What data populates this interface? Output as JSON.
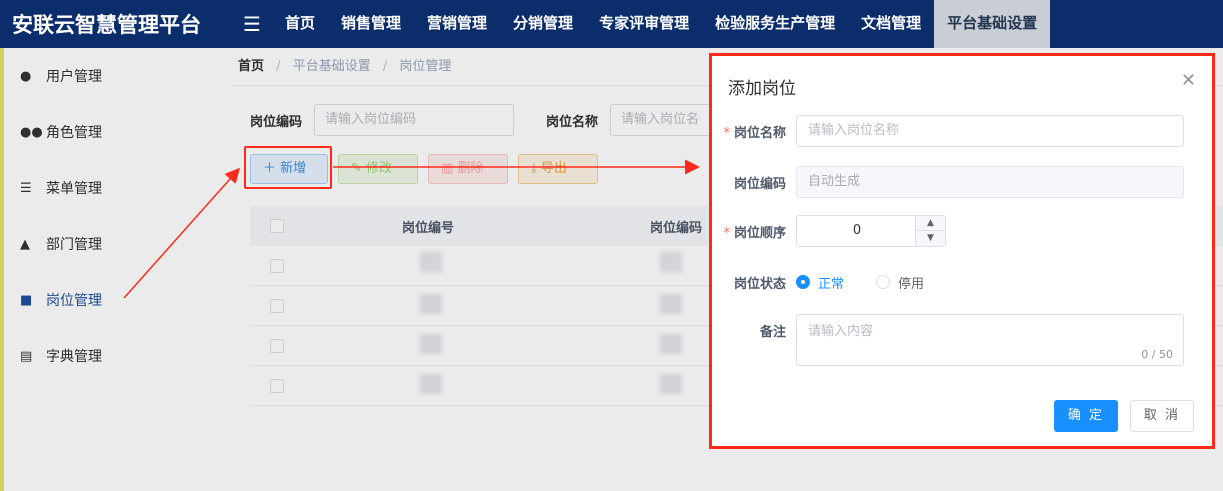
{
  "app": {
    "title": "安联云智慧管理平台"
  },
  "topnav": {
    "items": [
      "首页",
      "销售管理",
      "营销管理",
      "分销管理",
      "专家评审管理",
      "检验服务生产管理",
      "文档管理",
      "平台基础设置"
    ],
    "active": "平台基础设置"
  },
  "sidebar": {
    "items": [
      {
        "label": "用户管理",
        "icon": "user-icon"
      },
      {
        "label": "角色管理",
        "icon": "users-icon"
      },
      {
        "label": "菜单管理",
        "icon": "menu-tree-icon"
      },
      {
        "label": "部门管理",
        "icon": "org-tree-icon"
      },
      {
        "label": "岗位管理",
        "icon": "post-icon"
      },
      {
        "label": "字典管理",
        "icon": "dictionary-icon"
      }
    ],
    "active": "岗位管理"
  },
  "breadcrumb": [
    "首页",
    "平台基础设置",
    "岗位管理"
  ],
  "search": {
    "code_label": "岗位编码",
    "code_placeholder": "请输入岗位编码",
    "name_label": "岗位名称",
    "name_placeholder": "请输入岗位名"
  },
  "toolbar": {
    "add": "新增",
    "edit": "修改",
    "delete": "删除",
    "export": "导出"
  },
  "table": {
    "columns": [
      "岗位编号",
      "岗位编码"
    ]
  },
  "dialog": {
    "title": "添加岗位",
    "name_label": "岗位名称",
    "name_placeholder": "请输入岗位名称",
    "code_label": "岗位编码",
    "code_value": "自动生成",
    "order_label": "岗位顺序",
    "order_value": "0",
    "status_label": "岗位状态",
    "status_normal": "正常",
    "status_disabled": "停用",
    "status_selected": "正常",
    "remark_label": "备注",
    "remark_placeholder": "请输入内容",
    "remark_count": "0 / 50",
    "confirm": "确 定",
    "cancel": "取 消"
  },
  "colors": {
    "topbar": "#0b2d6b",
    "primary": "#1890ff",
    "annotation": "#ff2a1a"
  }
}
